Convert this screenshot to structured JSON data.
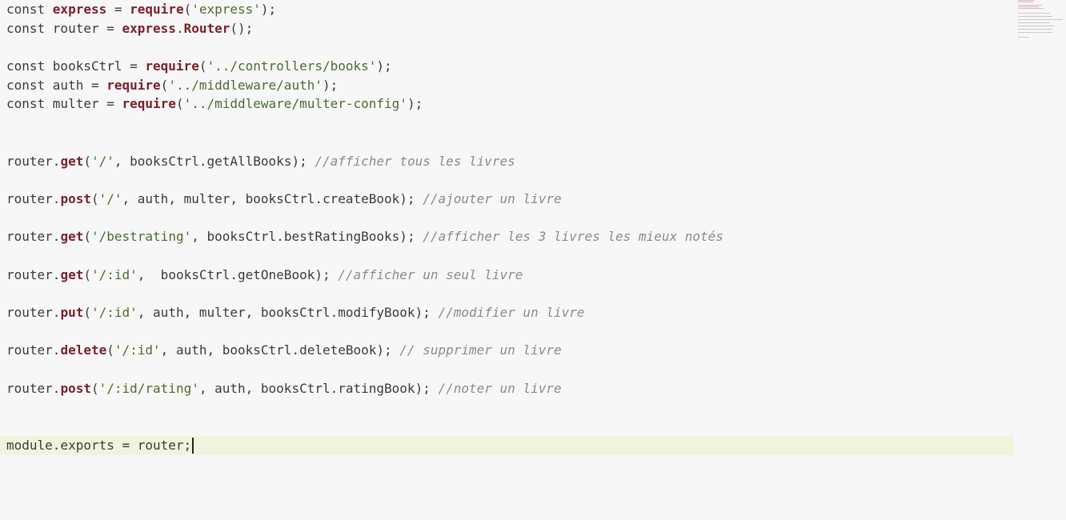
{
  "editor": {
    "lines": [
      [
        {
          "t": "kw",
          "v": "const "
        },
        {
          "t": "fn",
          "v": "express"
        },
        {
          "t": "kw",
          "v": " = "
        },
        {
          "t": "fn",
          "v": "require"
        },
        {
          "t": "kw",
          "v": "("
        },
        {
          "t": "str",
          "v": "'express'"
        },
        {
          "t": "kw",
          "v": ");"
        }
      ],
      [
        {
          "t": "kw",
          "v": "const router = "
        },
        {
          "t": "fn",
          "v": "express"
        },
        {
          "t": "kw",
          "v": "."
        },
        {
          "t": "fn",
          "v": "Router"
        },
        {
          "t": "kw",
          "v": "();"
        }
      ],
      [],
      [
        {
          "t": "kw",
          "v": "const booksCtrl = "
        },
        {
          "t": "fn",
          "v": "require"
        },
        {
          "t": "kw",
          "v": "("
        },
        {
          "t": "str",
          "v": "'../controllers/books'"
        },
        {
          "t": "kw",
          "v": ");"
        }
      ],
      [
        {
          "t": "kw",
          "v": "const auth = "
        },
        {
          "t": "fn",
          "v": "require"
        },
        {
          "t": "kw",
          "v": "("
        },
        {
          "t": "str",
          "v": "'../middleware/auth'"
        },
        {
          "t": "kw",
          "v": ");"
        }
      ],
      [
        {
          "t": "kw",
          "v": "const multer = "
        },
        {
          "t": "fn",
          "v": "require"
        },
        {
          "t": "kw",
          "v": "("
        },
        {
          "t": "str",
          "v": "'../middleware/multer-config'"
        },
        {
          "t": "kw",
          "v": ");"
        }
      ],
      [],
      [],
      [
        {
          "t": "kw",
          "v": "router."
        },
        {
          "t": "fn",
          "v": "get"
        },
        {
          "t": "kw",
          "v": "("
        },
        {
          "t": "str",
          "v": "'/'"
        },
        {
          "t": "kw",
          "v": ", booksCtrl.getAllBooks); "
        },
        {
          "t": "cmt",
          "v": "//afficher tous les livres"
        }
      ],
      [],
      [
        {
          "t": "kw",
          "v": "router."
        },
        {
          "t": "fn",
          "v": "post"
        },
        {
          "t": "kw",
          "v": "("
        },
        {
          "t": "str",
          "v": "'/'"
        },
        {
          "t": "kw",
          "v": ", auth, multer, booksCtrl.createBook); "
        },
        {
          "t": "cmt",
          "v": "//ajouter un livre"
        }
      ],
      [],
      [
        {
          "t": "kw",
          "v": "router."
        },
        {
          "t": "fn",
          "v": "get"
        },
        {
          "t": "kw",
          "v": "("
        },
        {
          "t": "str",
          "v": "'/bestrating'"
        },
        {
          "t": "kw",
          "v": ", booksCtrl.bestRatingBooks); "
        },
        {
          "t": "cmt",
          "v": "//afficher les 3 livres les mieux notés"
        }
      ],
      [],
      [
        {
          "t": "kw",
          "v": "router."
        },
        {
          "t": "fn",
          "v": "get"
        },
        {
          "t": "kw",
          "v": "("
        },
        {
          "t": "str",
          "v": "'/:id'"
        },
        {
          "t": "kw",
          "v": ",  booksCtrl.getOneBook); "
        },
        {
          "t": "cmt",
          "v": "//afficher un seul livre"
        }
      ],
      [],
      [
        {
          "t": "kw",
          "v": "router."
        },
        {
          "t": "fn",
          "v": "put"
        },
        {
          "t": "kw",
          "v": "("
        },
        {
          "t": "str",
          "v": "'/:id'"
        },
        {
          "t": "kw",
          "v": ", auth, multer, booksCtrl.modifyBook); "
        },
        {
          "t": "cmt",
          "v": "//modifier un livre"
        }
      ],
      [],
      [
        {
          "t": "kw",
          "v": "router."
        },
        {
          "t": "fn",
          "v": "delete"
        },
        {
          "t": "kw",
          "v": "("
        },
        {
          "t": "str",
          "v": "'/:id'"
        },
        {
          "t": "kw",
          "v": ", auth, booksCtrl.deleteBook); "
        },
        {
          "t": "cmt",
          "v": "// supprimer un livre"
        }
      ],
      [],
      [
        {
          "t": "kw",
          "v": "router."
        },
        {
          "t": "fn",
          "v": "post"
        },
        {
          "t": "kw",
          "v": "("
        },
        {
          "t": "str",
          "v": "'/:id/rating'"
        },
        {
          "t": "kw",
          "v": ", auth, booksCtrl.ratingBook); "
        },
        {
          "t": "cmt",
          "v": "//noter un livre"
        }
      ],
      [],
      [],
      [
        {
          "t": "kw",
          "v": "module.exports = router;"
        }
      ]
    ],
    "active_line": 23
  },
  "colors": {
    "background": "#f7f7f7",
    "active_line": "#eef5dc",
    "keyword_bold": "#7a1f2b",
    "string": "#4d6b2a",
    "comment": "#8a8a8a"
  }
}
